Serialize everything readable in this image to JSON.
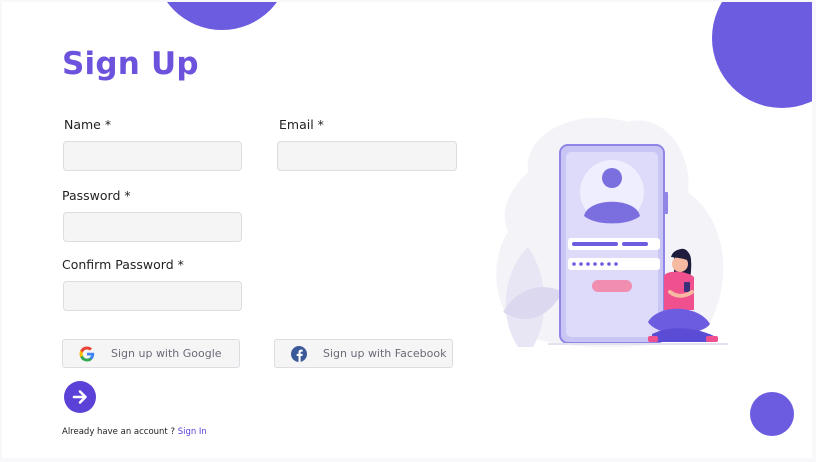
{
  "page": {
    "title": "Sign Up"
  },
  "form": {
    "name_label": "Name *",
    "name_value": "",
    "email_label": "Email *",
    "email_value": "",
    "password_label": "Password *",
    "password_value": "",
    "confirm_label": "Confirm Password *",
    "confirm_value": ""
  },
  "social": {
    "google_label": "Sign up with Google",
    "facebook_label": "Sign up with Facebook"
  },
  "footer": {
    "prompt": "Already have an account ?",
    "link": "Sign In"
  },
  "icons": {
    "submit": "arrow-right-icon",
    "google": "google-icon",
    "facebook": "facebook-icon"
  },
  "colors": {
    "accent": "#6c52dc",
    "accent_dark": "#5b41d8",
    "decor_circle": "#6c5ce0",
    "input_bg": "#f5f5f6",
    "illustration_shirt": "#f0508e"
  }
}
